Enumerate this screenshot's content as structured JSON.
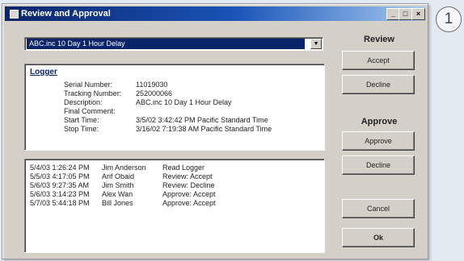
{
  "window": {
    "title": "Review and Approval"
  },
  "callout": {
    "number": "1"
  },
  "titlebar_buttons": {
    "minimize": "_",
    "maximize": "□",
    "close": "×"
  },
  "dropdown": {
    "selected": "ABC.inc 10 Day 1 Hour Delay"
  },
  "logger": {
    "heading": "Logger",
    "fields": [
      {
        "label": "Serial Number:",
        "value": "11019030"
      },
      {
        "label": "Tracking Number:",
        "value": "252000066"
      },
      {
        "label": "Description:",
        "value": "ABC.inc 10 Day 1 Hour Delay"
      },
      {
        "label": "Final Comment:",
        "value": ""
      },
      {
        "label": "Start Time:",
        "value": "3/5/02 3:42:42 PM  Pacific Standard Time"
      },
      {
        "label": "Stop Time:",
        "value": "3/16/02 7:19:38 AM  Pacific Standard Time"
      }
    ]
  },
  "log": [
    {
      "time": "5/4/03 1:26:24 PM",
      "user": "Jim Anderson",
      "action": "Read Logger"
    },
    {
      "time": "5/5/03 4:17:05 PM",
      "user": "Arif Obaid",
      "action": "Review: Accept"
    },
    {
      "time": "5/6/03 9:27:35 AM",
      "user": "Jim Smith",
      "action": "Review: Decline"
    },
    {
      "time": "5/6/03 3:14:23 PM",
      "user": "Alex Wan",
      "action": "Approve: Accept"
    },
    {
      "time": "5/7/03 5:44:18 PM",
      "user": "Bill Jones",
      "action": "Approve: Accept"
    }
  ],
  "review": {
    "heading": "Review",
    "accept": "Accept",
    "decline": "Decline"
  },
  "approve": {
    "heading": "Approve",
    "approve": "Approve",
    "decline": "Decline"
  },
  "actions": {
    "cancel": "Cancel",
    "ok": "Ok"
  }
}
